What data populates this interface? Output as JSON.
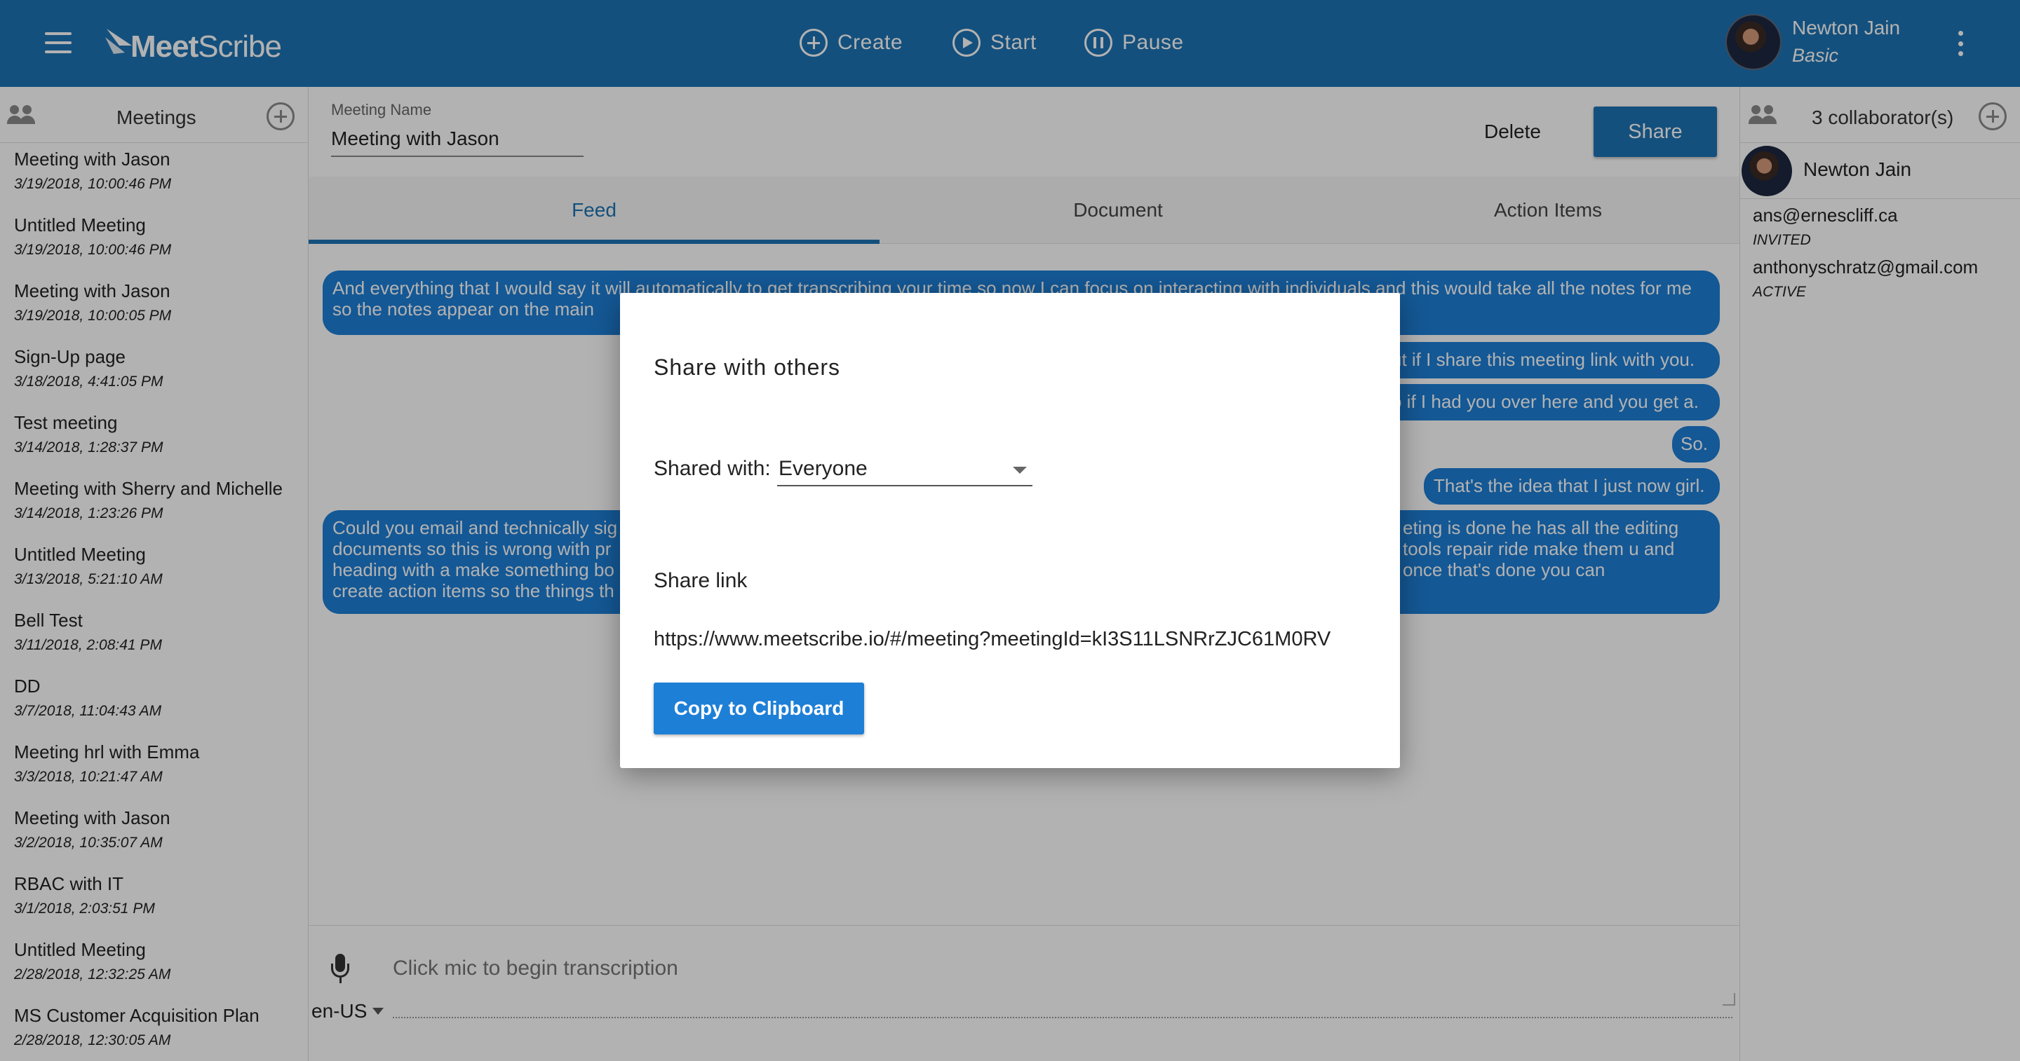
{
  "app": {
    "logo_text_bold": "Meet",
    "logo_text_light": "Scribe"
  },
  "toolbar": {
    "create_label": "Create",
    "start_label": "Start",
    "pause_label": "Pause"
  },
  "user": {
    "name": "Newton Jain",
    "plan": "Basic"
  },
  "meetings": {
    "title": "Meetings",
    "items": [
      {
        "name": "Meeting with Jason",
        "date": "3/19/2018, 10:00:46 PM"
      },
      {
        "name": "Untitled Meeting",
        "date": "3/19/2018, 10:00:46 PM"
      },
      {
        "name": "Meeting with Jason",
        "date": "3/19/2018, 10:00:05 PM"
      },
      {
        "name": "Sign-Up page",
        "date": "3/18/2018, 4:41:05 PM"
      },
      {
        "name": "Test meeting",
        "date": "3/14/2018, 1:28:37 PM"
      },
      {
        "name": "Meeting with Sherry and Michelle",
        "date": "3/14/2018, 1:23:26 PM"
      },
      {
        "name": "Untitled Meeting",
        "date": "3/13/2018, 5:21:10 AM"
      },
      {
        "name": "Bell Test",
        "date": "3/11/2018, 2:08:41 PM"
      },
      {
        "name": "DD",
        "date": "3/7/2018, 11:04:43 AM"
      },
      {
        "name": "Meeting hrl with Emma",
        "date": "3/3/2018, 10:21:47 AM"
      },
      {
        "name": "Meeting with Jason",
        "date": "3/2/2018, 10:35:07 AM"
      },
      {
        "name": "RBAC with IT",
        "date": "3/1/2018, 2:03:51 PM"
      },
      {
        "name": "Untitled Meeting",
        "date": "2/28/2018, 12:32:25 AM"
      },
      {
        "name": "MS Customer Acquisition Plan",
        "date": "2/28/2018, 12:30:05 AM"
      }
    ]
  },
  "meeting": {
    "name_label": "Meeting Name",
    "name_value": "Meeting with Jason",
    "delete_label": "Delete",
    "share_label": "Share"
  },
  "tabs": {
    "feed": "Feed",
    "document": "Document",
    "action_items": "Action Items"
  },
  "feed": {
    "b1": "And everything that I would say it will automatically to get transcribing your time so now I can focus on interacting with individuals and this would take all the notes for me so the notes appear on the main",
    "b2": "ut if I share this meeting link with you.",
    "b3": "o if I had you over here and you get a.",
    "b4": "So.",
    "b5": "That's the idea that I just now girl.",
    "b6_left": "Could you email and technically sig documents so this is wrong with pr heading with a make something bo create action items so the things th",
    "b6_right": "eting is done he has all the editing tools repair ride make them u and once that's done you can"
  },
  "transcription": {
    "placeholder": "Click mic to begin transcription",
    "language": "en-US"
  },
  "collaborators": {
    "title": "3 collaborator(s)",
    "owner": "Newton Jain",
    "list": [
      {
        "email": "ans@ernescliff.ca",
        "status": "INVITED"
      },
      {
        "email": "anthonyschratz@gmail.com",
        "status": "ACTIVE"
      }
    ]
  },
  "share_dialog": {
    "title": "Share with others",
    "shared_with_label": "Shared with:",
    "shared_with_value": "Everyone",
    "share_link_label": "Share link",
    "share_link_url": "https://www.meetscribe.io/#/meeting?meetingId=kI3S11LSNRrZJC61M0RV",
    "copy_label": "Copy to Clipboard"
  },
  "colors": {
    "primary": "#1e73b3",
    "bubble": "#1e7fd6",
    "overlay": "rgba(0,0,0,0.3)"
  }
}
